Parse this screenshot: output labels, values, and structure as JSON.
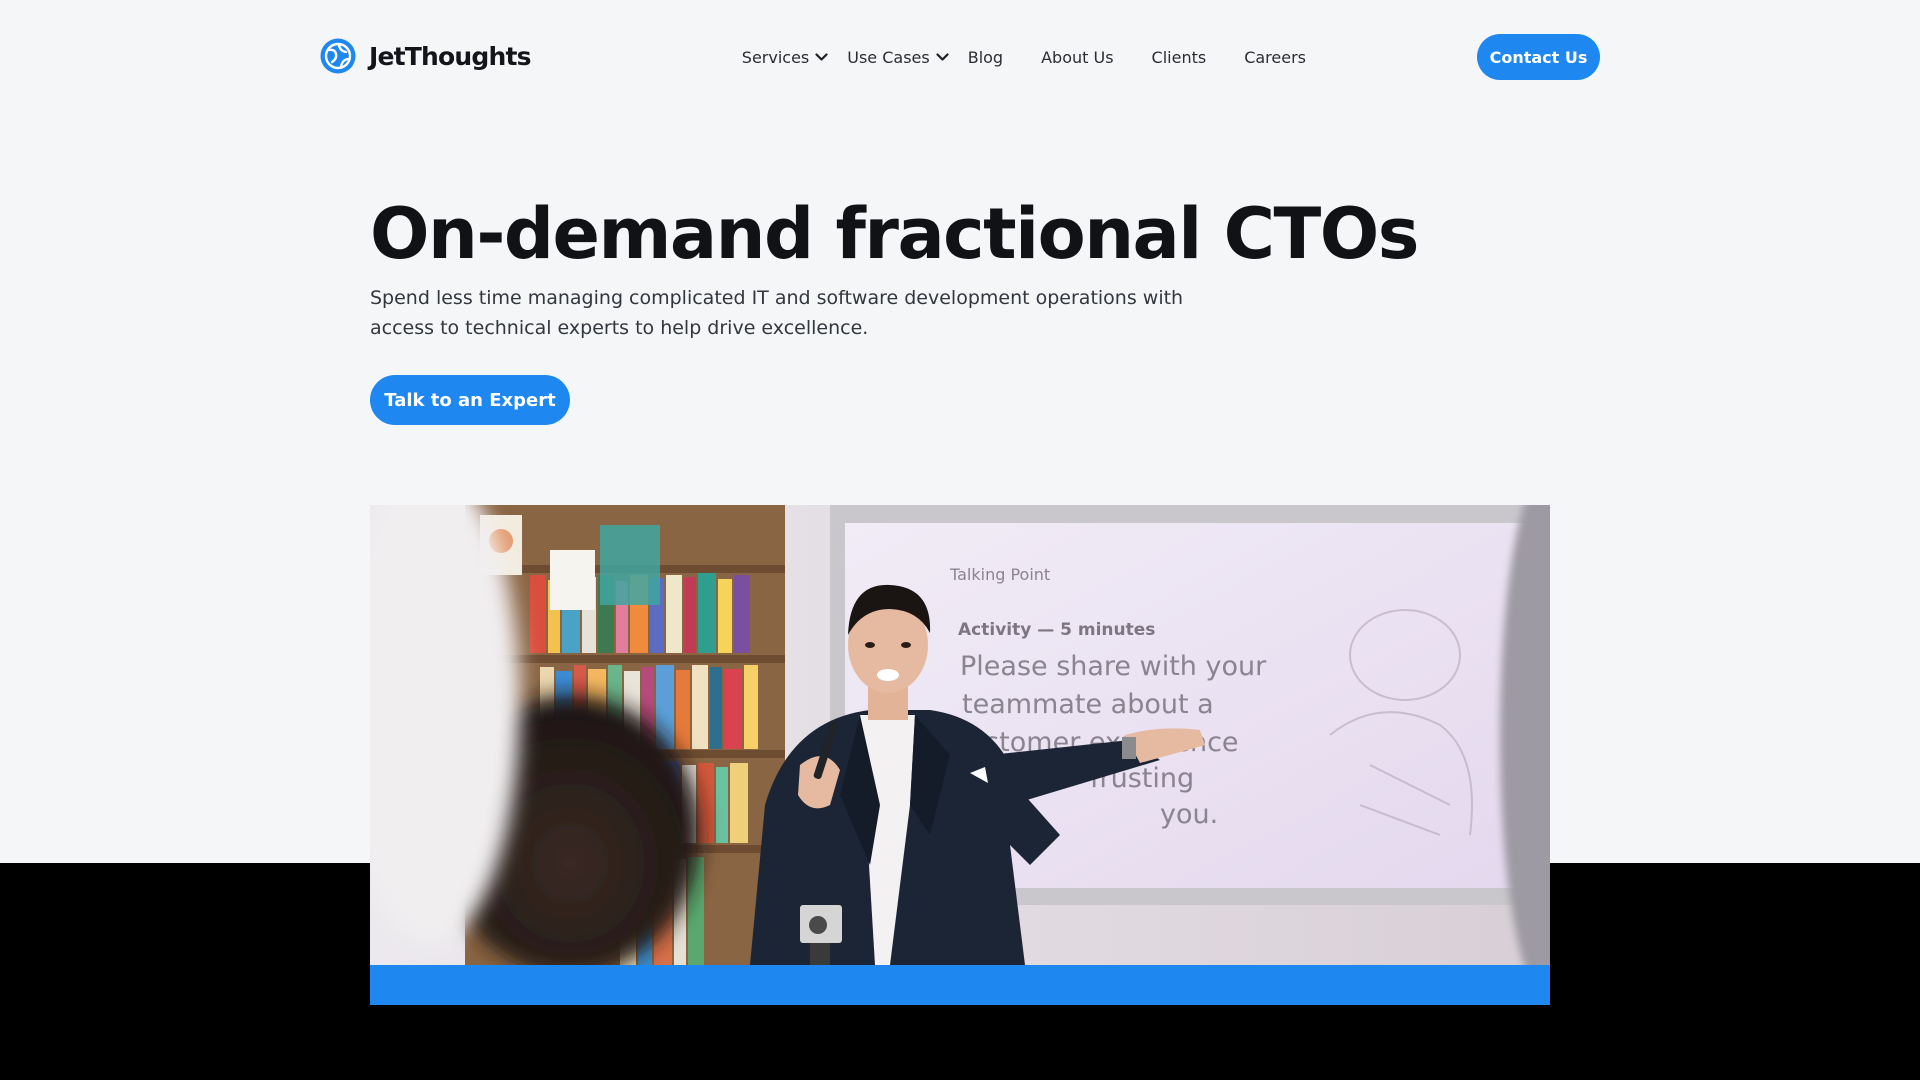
{
  "brand": {
    "name": "JetThoughts",
    "logo_icon": "globe-logo-icon",
    "accent_color": "#1e87f0"
  },
  "nav": {
    "items": [
      {
        "label": "Services",
        "dropdown": true
      },
      {
        "label": "Use Cases",
        "dropdown": true
      },
      {
        "label": "Blog",
        "dropdown": false
      },
      {
        "label": "About Us",
        "dropdown": false
      },
      {
        "label": "Clients",
        "dropdown": false
      },
      {
        "label": "Careers",
        "dropdown": false
      }
    ],
    "contact_label": "Contact Us"
  },
  "hero": {
    "title": "On-demand fractional CTOs",
    "subtitle": "Spend less time managing complicated IT and software development operations with access to technical experts to help drive excellence.",
    "cta_label": "Talk to an Expert",
    "image": {
      "screen_heading": "Talking Point",
      "screen_activity": "Activity — 5 minutes",
      "screen_lines": [
        "Please share with your",
        "teammate about a",
        "ustomer experience",
        "frusting",
        "you."
      ]
    }
  },
  "colors": {
    "page_background": "#f4f6f8",
    "band": "#000000",
    "title": "#111216"
  }
}
